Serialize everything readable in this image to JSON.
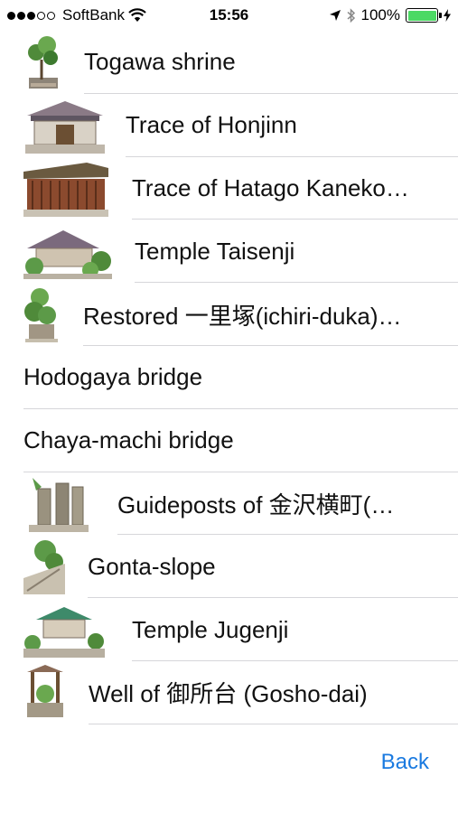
{
  "status_bar": {
    "carrier": "SoftBank",
    "time": "15:56",
    "battery": "100%",
    "battery_level": 1.0,
    "battery_color": "#4cd964"
  },
  "list": {
    "items": [
      {
        "label": "Togawa shrine",
        "thumbnail": "shrine-illustration-icon"
      },
      {
        "label": "Trace of Honjinn",
        "thumbnail": "gate-illustration-icon"
      },
      {
        "label": "Trace of Hatago Kaneko…",
        "thumbnail": "inn-illustration-icon"
      },
      {
        "label": "Temple Taisenji",
        "thumbnail": "temple-illustration-icon"
      },
      {
        "label": "Restored 一里塚(ichiri-duka)…",
        "thumbnail": "milestone-illustration-icon"
      },
      {
        "label": "Hodogaya bridge",
        "thumbnail": ""
      },
      {
        "label": "Chaya-machi bridge",
        "thumbnail": ""
      },
      {
        "label": "Guideposts of 金沢横町(…",
        "thumbnail": "guidepost-illustration-icon"
      },
      {
        "label": "Gonta-slope",
        "thumbnail": "slope-illustration-icon"
      },
      {
        "label": "Temple Jugenji",
        "thumbnail": "pagoda-illustration-icon"
      },
      {
        "label": "Well of 御所台 (Gosho-dai)",
        "thumbnail": "well-illustration-icon"
      }
    ]
  },
  "footer": {
    "back_label": "Back",
    "back_color": "#1a7ae0"
  }
}
